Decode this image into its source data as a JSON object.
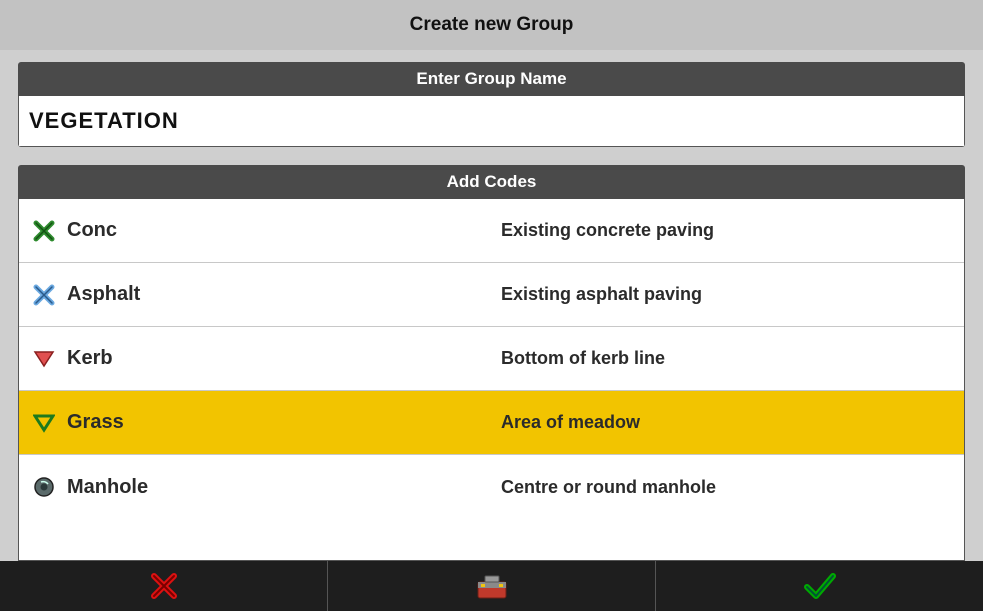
{
  "title": "Create new Group",
  "sections": {
    "group_name_label": "Enter Group Name",
    "group_name_value": "VEGETATION",
    "add_codes_label": "Add Codes"
  },
  "codes": [
    {
      "icon": "x-green",
      "name": "Conc",
      "desc": "Existing concrete paving",
      "selected": false
    },
    {
      "icon": "x-blue",
      "name": "Asphalt",
      "desc": "Existing asphalt paving",
      "selected": false
    },
    {
      "icon": "tri-red",
      "name": "Kerb",
      "desc": "Bottom of kerb line",
      "selected": false
    },
    {
      "icon": "tri-green",
      "name": "Grass",
      "desc": "Area of meadow",
      "selected": true
    },
    {
      "icon": "circle",
      "name": "Manhole",
      "desc": "Centre or round manhole",
      "selected": false
    }
  ],
  "bottombar": {
    "cancel": "cancel",
    "toolbox": "toolbox",
    "confirm": "confirm"
  }
}
